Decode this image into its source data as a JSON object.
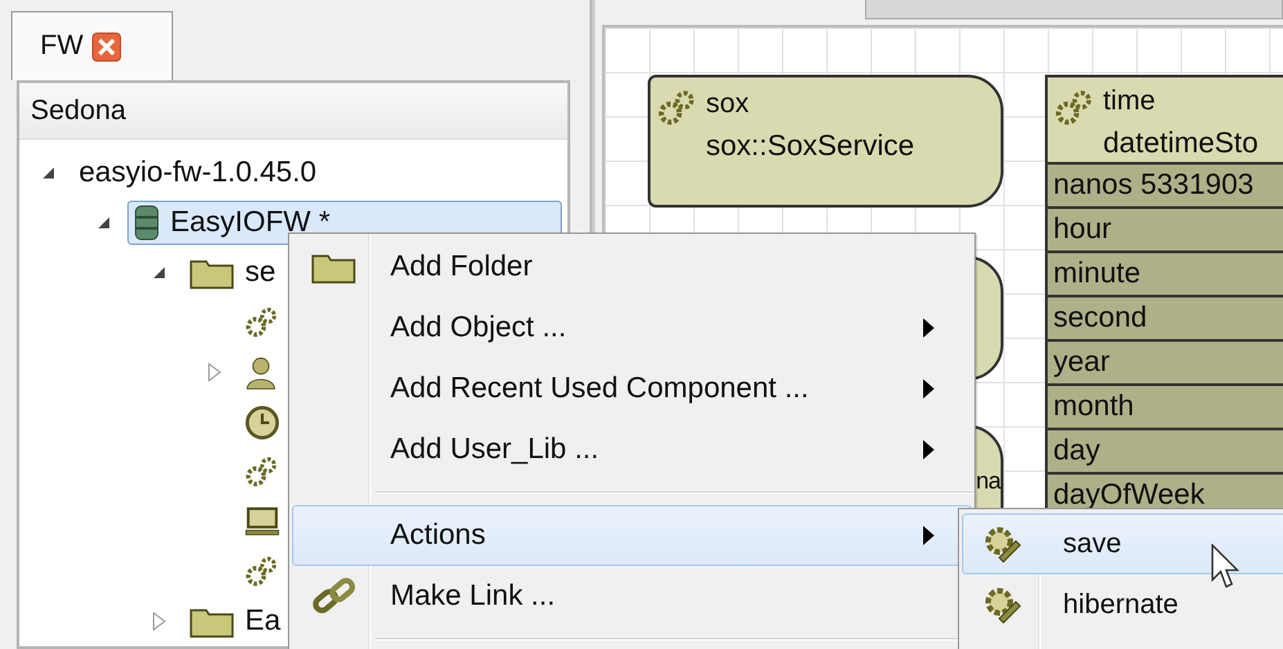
{
  "tab": {
    "label": "FW"
  },
  "tree": {
    "header": "Sedona",
    "items": [
      {
        "label": "easyio-fw-1.0.45.0",
        "expanded": true,
        "selected": false,
        "children": [
          {
            "label": "EasyIOFW *",
            "kind": "database",
            "expanded": true,
            "selected": true,
            "children": [
              {
                "label": "se",
                "kind": "folder",
                "expanded": true,
                "selected": false,
                "children": [
                  {
                    "kind": "gears",
                    "selected": false
                  },
                  {
                    "kind": "person",
                    "expanded": false,
                    "selected": false
                  },
                  {
                    "kind": "clock",
                    "selected": false
                  },
                  {
                    "kind": "gears",
                    "selected": false
                  },
                  {
                    "kind": "monitor",
                    "selected": false
                  },
                  {
                    "kind": "gears",
                    "selected": false
                  }
                ]
              },
              {
                "label": "Ea",
                "kind": "folder",
                "expanded": false,
                "selected": false
              }
            ]
          }
        ]
      }
    ]
  },
  "canvas": {
    "nodes": [
      {
        "kind": "service",
        "title": "sox",
        "subtitle": "sox::SoxService"
      },
      {
        "kind": "hidden"
      },
      {
        "kind": "hidden",
        "subtitle": "na"
      },
      {
        "kind": "table",
        "title": "time",
        "subtitle": "datetimeSto",
        "slots": [
          "nanos 5331903",
          "hour",
          "minute",
          "second",
          "year",
          "month",
          "day",
          "dayOfWeek"
        ]
      }
    ]
  },
  "context_menu": {
    "items": [
      {
        "kind": "folder",
        "label": "Add Folder",
        "submenu": false,
        "selected": false
      },
      {
        "kind": "plain",
        "label": "Add Object ...",
        "submenu": true,
        "selected": false
      },
      {
        "kind": "plain",
        "label": "Add Recent Used Component ...",
        "submenu": true,
        "selected": false
      },
      {
        "kind": "plain",
        "label": "Add User_Lib ...",
        "submenu": true,
        "selected": false
      },
      {
        "kind": "separator"
      },
      {
        "kind": "plain",
        "label": "Actions",
        "submenu": true,
        "selected": true
      },
      {
        "kind": "link",
        "label": "Make Link ...",
        "submenu": false,
        "selected": false
      },
      {
        "kind": "separator"
      }
    ]
  },
  "submenu": {
    "items": [
      {
        "label": "save",
        "selected": true
      },
      {
        "label": "hibernate",
        "selected": false
      }
    ]
  }
}
